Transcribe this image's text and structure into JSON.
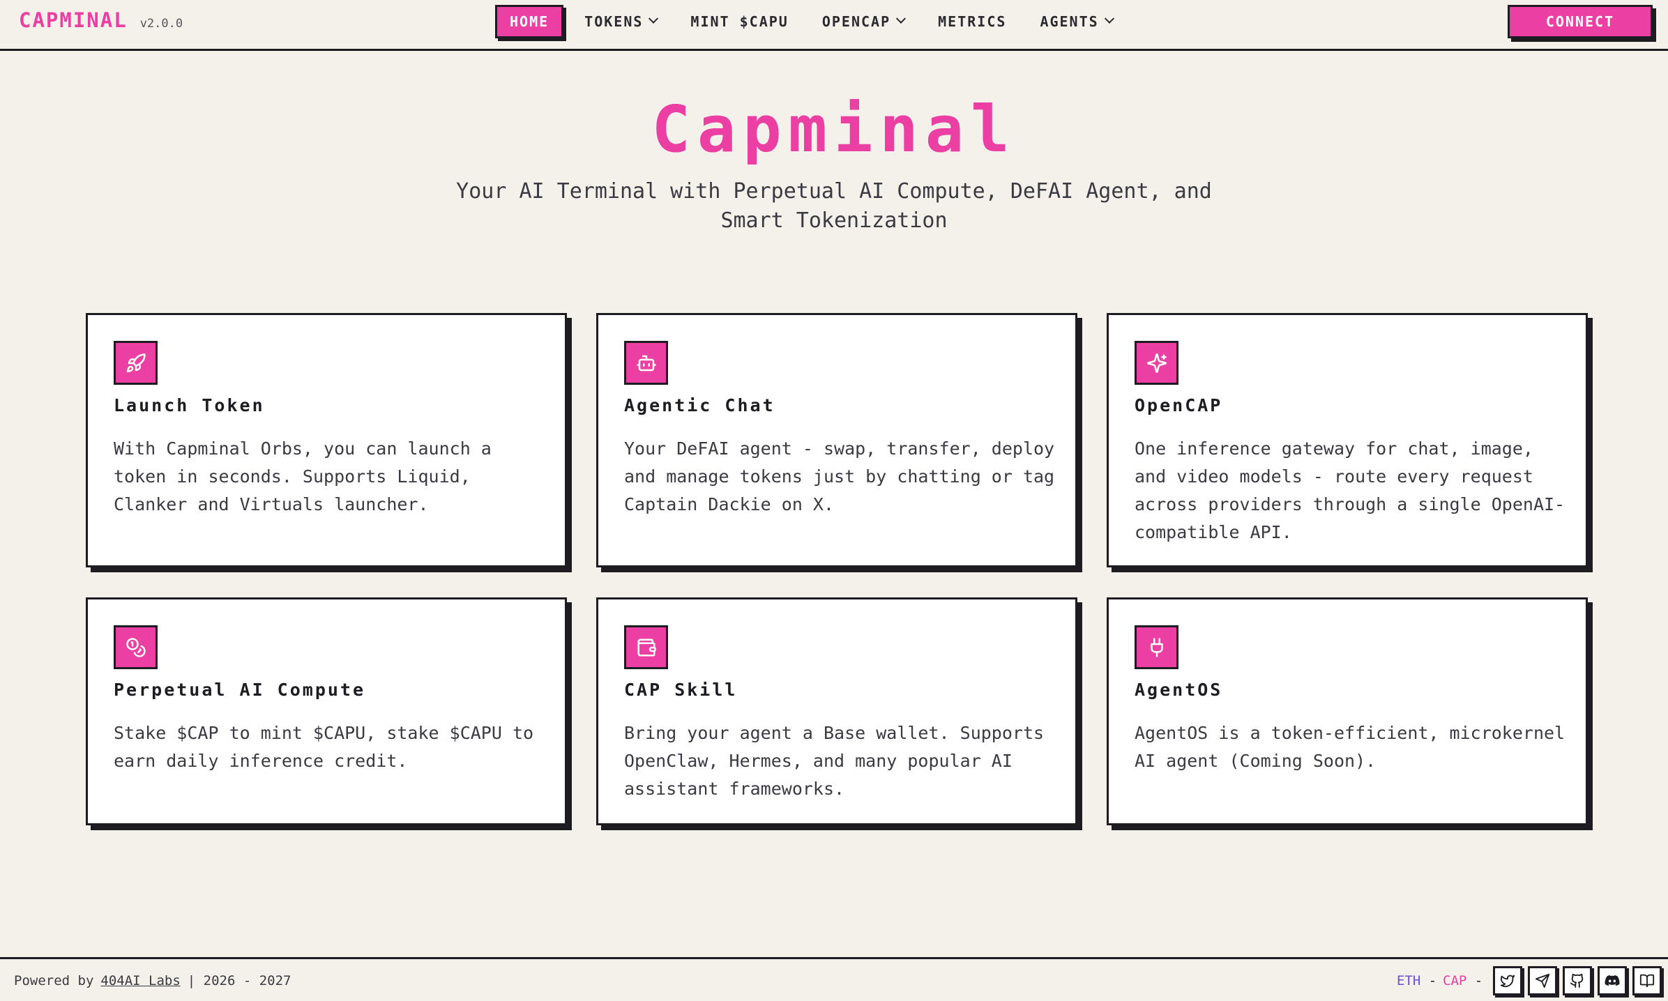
{
  "header": {
    "brand": "CAPMINAL",
    "version": "v2.0.0",
    "nav": [
      {
        "label": "HOME",
        "active": true,
        "dropdown": false
      },
      {
        "label": "TOKENS",
        "active": false,
        "dropdown": true
      },
      {
        "label": "MINT $CAPU",
        "active": false,
        "dropdown": false
      },
      {
        "label": "OPENCAP",
        "active": false,
        "dropdown": true
      },
      {
        "label": "METRICS",
        "active": false,
        "dropdown": false
      },
      {
        "label": "AGENTS",
        "active": false,
        "dropdown": true
      }
    ],
    "connect_label": "CONNECT"
  },
  "hero": {
    "title": "Capminal",
    "subtitle": "Your AI Terminal with Perpetual AI Compute, DeFAI Agent, and Smart Tokenization"
  },
  "cards": [
    {
      "icon": "rocket-icon",
      "title": "Launch Token",
      "description": "With Capminal Orbs, you can launch a token in seconds. Supports Liquid, Clanker and Virtuals launcher."
    },
    {
      "icon": "bot-icon",
      "title": "Agentic Chat",
      "description": "Your DeFAI agent - swap, transfer, deploy and manage tokens just by chatting or tag Captain Dackie on X."
    },
    {
      "icon": "sparkles-icon",
      "title": "OpenCAP",
      "description": "One inference gateway for chat, image, and video models - route every request across providers through a single OpenAI-compatible API."
    },
    {
      "icon": "coins-icon",
      "title": "Perpetual AI Compute",
      "description": "Stake $CAP to mint $CAPU, stake $CAPU to earn daily inference credit."
    },
    {
      "icon": "wallet-icon",
      "title": "CAP Skill",
      "description": "Bring your agent a Base wallet. Supports OpenClaw, Hermes, and many popular AI assistant frameworks."
    },
    {
      "icon": "plug-icon",
      "title": "AgentOS",
      "description": "AgentOS is a token-efficient, microkernel AI agent (Coming Soon)."
    }
  ],
  "footer": {
    "powered_by": "Powered by",
    "company": "404AI Labs",
    "years": "| 2026 - 2027",
    "eth_label": "ETH",
    "eth_value": "-",
    "cap_label": "CAP",
    "cap_value": "-",
    "social": [
      "twitter-icon",
      "telegram-icon",
      "github-icon",
      "discord-icon",
      "docs-icon"
    ]
  },
  "colors": {
    "accent": "#ec3fa3",
    "ink": "#1c1c22",
    "background": "#f4f1ea",
    "eth": "#6b4fd8"
  }
}
